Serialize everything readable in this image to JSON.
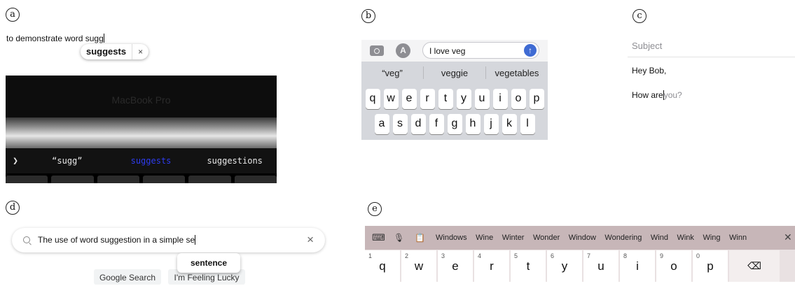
{
  "panel_labels": {
    "a": "a",
    "b": "b",
    "c": "c",
    "d": "d",
    "e": "e"
  },
  "panel_a": {
    "typed_text": "to demonstrate word sugg",
    "popup_suggestion": "suggests",
    "popup_close": "×",
    "laptop_brand": "MacBook Pro",
    "touchbar": {
      "chevron": "❯",
      "suggestions": [
        "“sugg”",
        "suggests",
        "suggestions"
      ],
      "highlight_color": "#2e3cf0"
    }
  },
  "panel_b": {
    "camera_icon": "camera-icon",
    "appstore_icon": "A",
    "message_text": "I love veg",
    "send_icon": "↑",
    "suggestions": [
      "“veg”",
      "veggie",
      "vegetables"
    ],
    "keyboard_row1": [
      "q",
      "w",
      "e",
      "r",
      "t",
      "y",
      "u",
      "i",
      "o",
      "p"
    ],
    "keyboard_row2": [
      "a",
      "s",
      "d",
      "f",
      "g",
      "h",
      "j",
      "k",
      "l"
    ]
  },
  "panel_c": {
    "subject_label": "Subject",
    "greeting": "Hey Bob,",
    "typed": "How are",
    "prediction": "you?"
  },
  "panel_d": {
    "query": "The use of word suggestion in a simple se",
    "clear_icon": "×",
    "suggestion": "sentence",
    "buttons": [
      "Google Search",
      "I'm Feeling Lucky"
    ]
  },
  "panel_e": {
    "toolbar_icons": {
      "keyboard": "⌨",
      "mic": "🎙",
      "clipboard": "📋"
    },
    "suggestions": [
      "Windows",
      "Wine",
      "Winter",
      "Wonder",
      "Window",
      "Wondering",
      "Wind",
      "Wink",
      "Wing",
      "Winn"
    ],
    "close_icon": "✕",
    "keys": [
      {
        "num": "1",
        "ch": "q"
      },
      {
        "num": "2",
        "ch": "w"
      },
      {
        "num": "3",
        "ch": "e"
      },
      {
        "num": "4",
        "ch": "r"
      },
      {
        "num": "5",
        "ch": "t"
      },
      {
        "num": "6",
        "ch": "y"
      },
      {
        "num": "7",
        "ch": "u"
      },
      {
        "num": "8",
        "ch": "i"
      },
      {
        "num": "9",
        "ch": "o"
      },
      {
        "num": "0",
        "ch": "p"
      }
    ],
    "backspace": "⌫"
  }
}
